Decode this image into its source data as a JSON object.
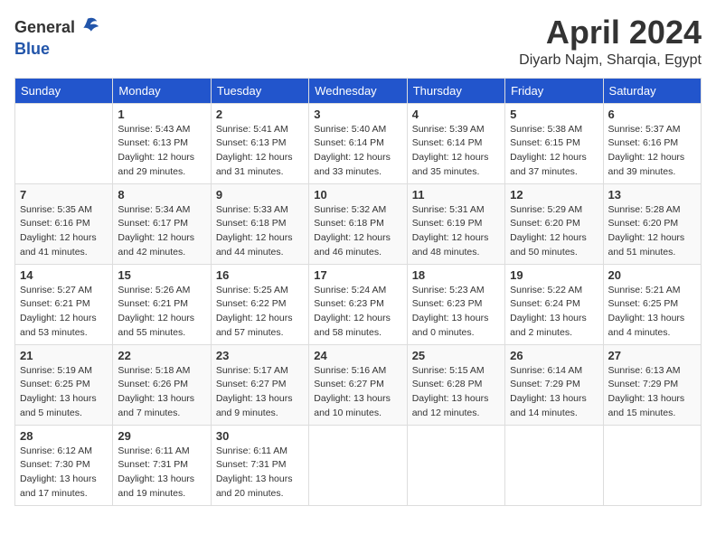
{
  "header": {
    "logo_general": "General",
    "logo_blue": "Blue",
    "month_title": "April 2024",
    "location": "Diyarb Najm, Sharqia, Egypt"
  },
  "weekdays": [
    "Sunday",
    "Monday",
    "Tuesday",
    "Wednesday",
    "Thursday",
    "Friday",
    "Saturday"
  ],
  "weeks": [
    [
      {
        "day": "",
        "info": ""
      },
      {
        "day": "1",
        "info": "Sunrise: 5:43 AM\nSunset: 6:13 PM\nDaylight: 12 hours\nand 29 minutes."
      },
      {
        "day": "2",
        "info": "Sunrise: 5:41 AM\nSunset: 6:13 PM\nDaylight: 12 hours\nand 31 minutes."
      },
      {
        "day": "3",
        "info": "Sunrise: 5:40 AM\nSunset: 6:14 PM\nDaylight: 12 hours\nand 33 minutes."
      },
      {
        "day": "4",
        "info": "Sunrise: 5:39 AM\nSunset: 6:14 PM\nDaylight: 12 hours\nand 35 minutes."
      },
      {
        "day": "5",
        "info": "Sunrise: 5:38 AM\nSunset: 6:15 PM\nDaylight: 12 hours\nand 37 minutes."
      },
      {
        "day": "6",
        "info": "Sunrise: 5:37 AM\nSunset: 6:16 PM\nDaylight: 12 hours\nand 39 minutes."
      }
    ],
    [
      {
        "day": "7",
        "info": "Sunrise: 5:35 AM\nSunset: 6:16 PM\nDaylight: 12 hours\nand 41 minutes."
      },
      {
        "day": "8",
        "info": "Sunrise: 5:34 AM\nSunset: 6:17 PM\nDaylight: 12 hours\nand 42 minutes."
      },
      {
        "day": "9",
        "info": "Sunrise: 5:33 AM\nSunset: 6:18 PM\nDaylight: 12 hours\nand 44 minutes."
      },
      {
        "day": "10",
        "info": "Sunrise: 5:32 AM\nSunset: 6:18 PM\nDaylight: 12 hours\nand 46 minutes."
      },
      {
        "day": "11",
        "info": "Sunrise: 5:31 AM\nSunset: 6:19 PM\nDaylight: 12 hours\nand 48 minutes."
      },
      {
        "day": "12",
        "info": "Sunrise: 5:29 AM\nSunset: 6:20 PM\nDaylight: 12 hours\nand 50 minutes."
      },
      {
        "day": "13",
        "info": "Sunrise: 5:28 AM\nSunset: 6:20 PM\nDaylight: 12 hours\nand 51 minutes."
      }
    ],
    [
      {
        "day": "14",
        "info": "Sunrise: 5:27 AM\nSunset: 6:21 PM\nDaylight: 12 hours\nand 53 minutes."
      },
      {
        "day": "15",
        "info": "Sunrise: 5:26 AM\nSunset: 6:21 PM\nDaylight: 12 hours\nand 55 minutes."
      },
      {
        "day": "16",
        "info": "Sunrise: 5:25 AM\nSunset: 6:22 PM\nDaylight: 12 hours\nand 57 minutes."
      },
      {
        "day": "17",
        "info": "Sunrise: 5:24 AM\nSunset: 6:23 PM\nDaylight: 12 hours\nand 58 minutes."
      },
      {
        "day": "18",
        "info": "Sunrise: 5:23 AM\nSunset: 6:23 PM\nDaylight: 13 hours\nand 0 minutes."
      },
      {
        "day": "19",
        "info": "Sunrise: 5:22 AM\nSunset: 6:24 PM\nDaylight: 13 hours\nand 2 minutes."
      },
      {
        "day": "20",
        "info": "Sunrise: 5:21 AM\nSunset: 6:25 PM\nDaylight: 13 hours\nand 4 minutes."
      }
    ],
    [
      {
        "day": "21",
        "info": "Sunrise: 5:19 AM\nSunset: 6:25 PM\nDaylight: 13 hours\nand 5 minutes."
      },
      {
        "day": "22",
        "info": "Sunrise: 5:18 AM\nSunset: 6:26 PM\nDaylight: 13 hours\nand 7 minutes."
      },
      {
        "day": "23",
        "info": "Sunrise: 5:17 AM\nSunset: 6:27 PM\nDaylight: 13 hours\nand 9 minutes."
      },
      {
        "day": "24",
        "info": "Sunrise: 5:16 AM\nSunset: 6:27 PM\nDaylight: 13 hours\nand 10 minutes."
      },
      {
        "day": "25",
        "info": "Sunrise: 5:15 AM\nSunset: 6:28 PM\nDaylight: 13 hours\nand 12 minutes."
      },
      {
        "day": "26",
        "info": "Sunrise: 6:14 AM\nSunset: 7:29 PM\nDaylight: 13 hours\nand 14 minutes."
      },
      {
        "day": "27",
        "info": "Sunrise: 6:13 AM\nSunset: 7:29 PM\nDaylight: 13 hours\nand 15 minutes."
      }
    ],
    [
      {
        "day": "28",
        "info": "Sunrise: 6:12 AM\nSunset: 7:30 PM\nDaylight: 13 hours\nand 17 minutes."
      },
      {
        "day": "29",
        "info": "Sunrise: 6:11 AM\nSunset: 7:31 PM\nDaylight: 13 hours\nand 19 minutes."
      },
      {
        "day": "30",
        "info": "Sunrise: 6:11 AM\nSunset: 7:31 PM\nDaylight: 13 hours\nand 20 minutes."
      },
      {
        "day": "",
        "info": ""
      },
      {
        "day": "",
        "info": ""
      },
      {
        "day": "",
        "info": ""
      },
      {
        "day": "",
        "info": ""
      }
    ]
  ]
}
